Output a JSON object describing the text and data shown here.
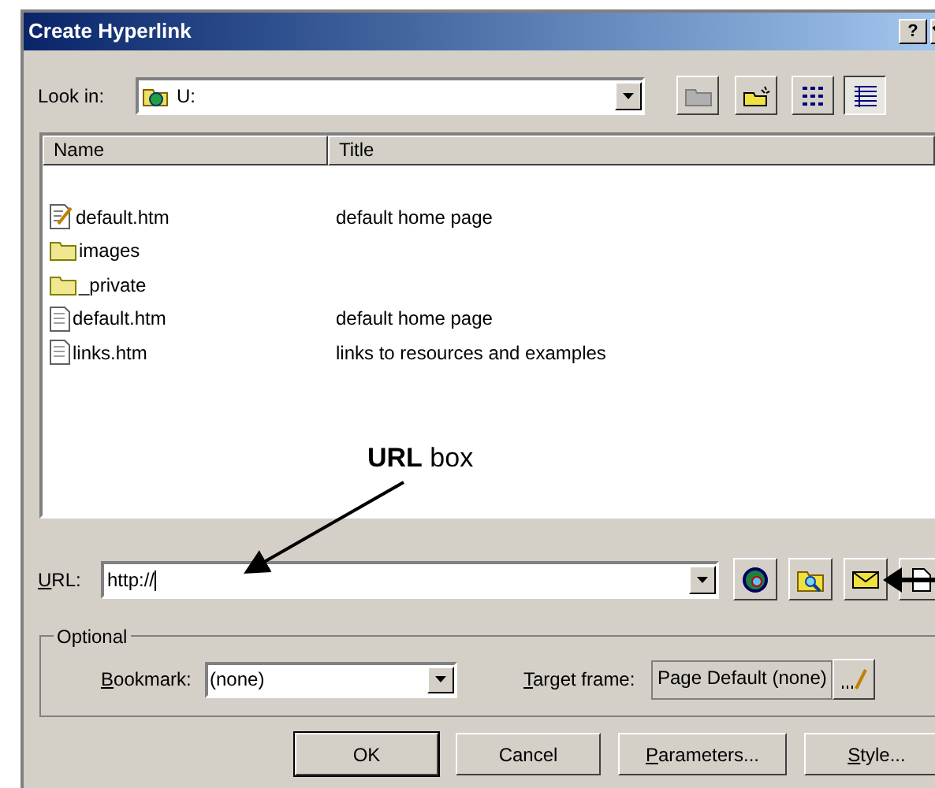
{
  "window": {
    "title": "Create Hyperlink",
    "help_button": "?"
  },
  "look_in": {
    "label": "Look in:",
    "value": "U:"
  },
  "file_list": {
    "columns": [
      "Name",
      "Title"
    ],
    "rows": [
      {
        "kind": "edited-page",
        "name": "default.htm",
        "title": "default home page"
      },
      {
        "kind": "folder",
        "name": "images"
      },
      {
        "kind": "folder",
        "name": "_private"
      },
      {
        "kind": "page",
        "name": "default.htm",
        "title": "default home page"
      },
      {
        "kind": "page",
        "name": "links.htm",
        "title": "links to resources and examples"
      }
    ]
  },
  "url": {
    "label": "URL:",
    "underline_first": true,
    "value": "http://"
  },
  "optional": {
    "title": "Optional",
    "bookmark": {
      "label": "Bookmark:",
      "underline_first": true,
      "value": "(none)"
    },
    "target_frame": {
      "label": "Target frame:",
      "underline_first": true,
      "value": "Page Default (none)"
    }
  },
  "buttons": [
    {
      "label": "OK",
      "default": true,
      "underline_first": false
    },
    {
      "label": "Cancel",
      "default": false,
      "underline_first": false
    },
    {
      "label": "Parameters...",
      "default": false,
      "underline_first": true
    },
    {
      "label": "Style...",
      "default": false,
      "underline_first": true
    }
  ],
  "annotation": {
    "text": "**URL** box"
  }
}
